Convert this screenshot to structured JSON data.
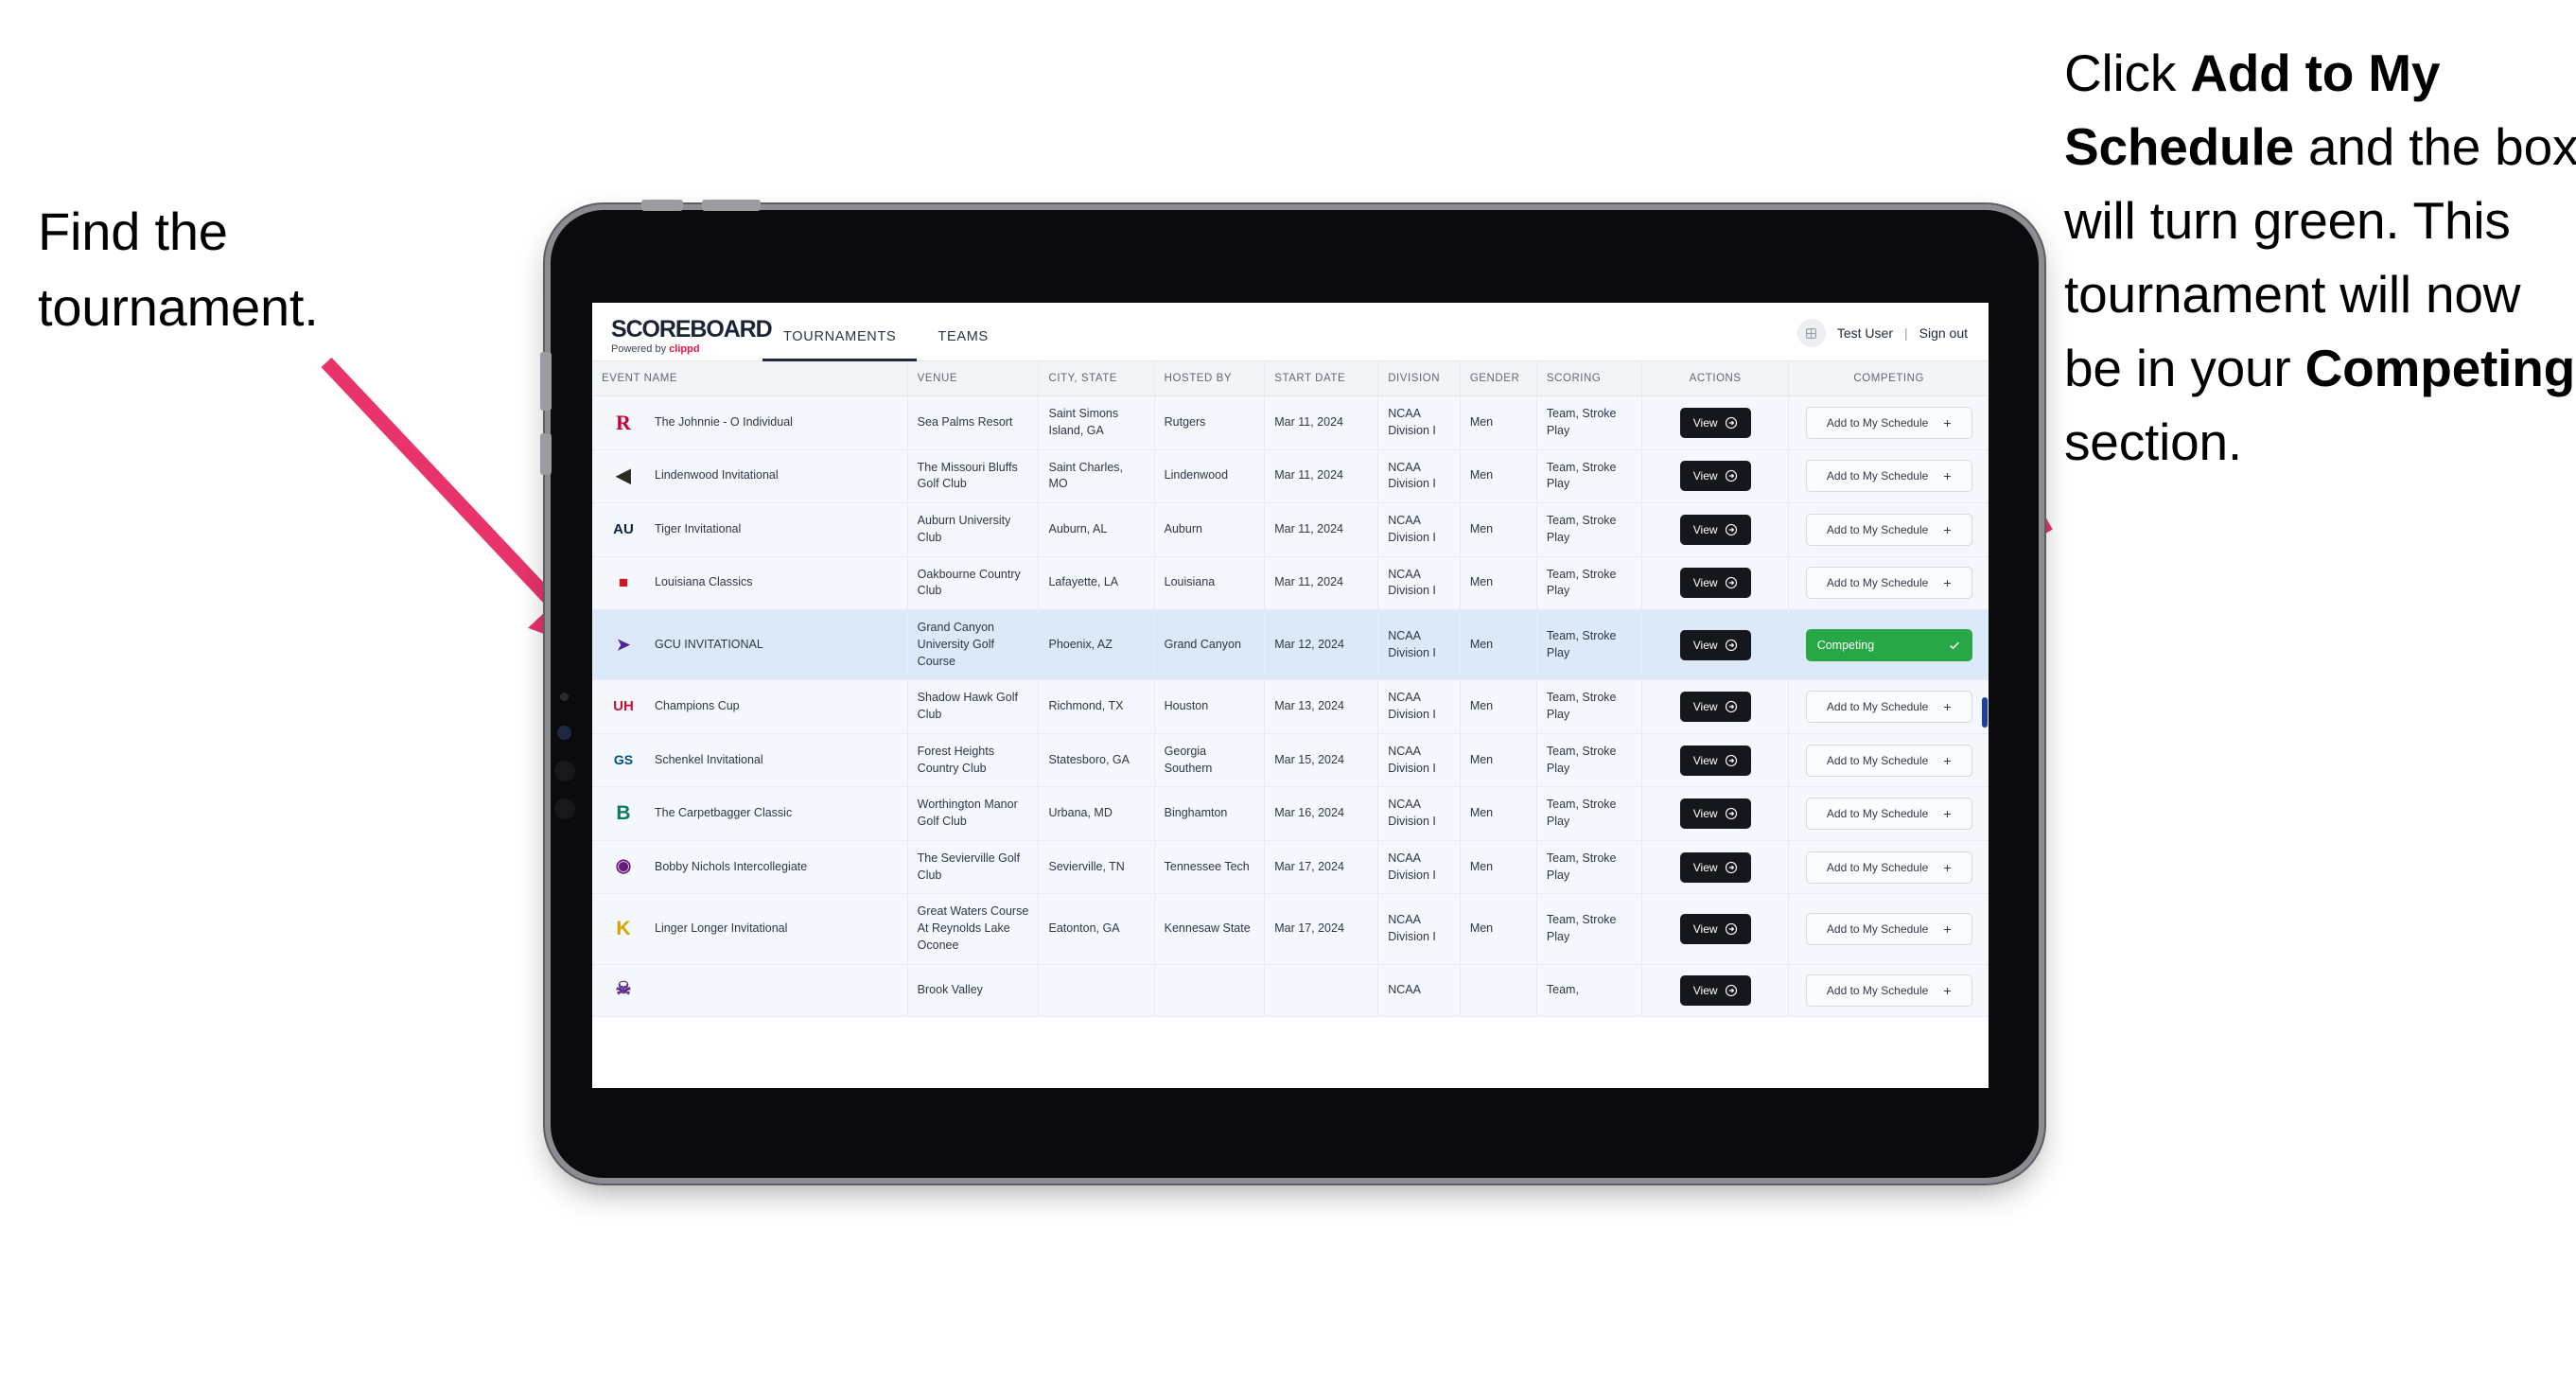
{
  "annotations": {
    "left": "Find the tournament.",
    "right_parts": [
      {
        "t": "Click ",
        "b": false
      },
      {
        "t": "Add to My Schedule",
        "b": true
      },
      {
        "t": " and the box will turn green. This tournament will now be in your ",
        "b": false
      },
      {
        "t": "Competing",
        "b": true
      },
      {
        "t": " section.",
        "b": false
      }
    ],
    "arrow_color": "#e8336b"
  },
  "app": {
    "brand": {
      "title": "SCOREBOARD",
      "sub_prefix": "Powered by ",
      "sub_brand": "clippd"
    },
    "nav": [
      {
        "label": "TOURNAMENTS",
        "active": true
      },
      {
        "label": "TEAMS",
        "active": false
      }
    ],
    "header_right": {
      "avatar_icon": "user-grid-icon",
      "user": "Test User",
      "separator": "|",
      "sign_out": "Sign out"
    },
    "table": {
      "columns": [
        "EVENT NAME",
        "VENUE",
        "CITY, STATE",
        "HOSTED BY",
        "START DATE",
        "DIVISION",
        "GENDER",
        "SCORING",
        "ACTIONS",
        "COMPETING"
      ],
      "view_label": "View",
      "add_label": "Add to My Schedule",
      "competing_label": "Competing",
      "rows": [
        {
          "event": "The Johnnie - O Individual",
          "logo": "rutgers-logo",
          "venue": "Sea Palms Resort",
          "city": "Saint Simons Island, GA",
          "host": "Rutgers",
          "date": "Mar 11, 2024",
          "division": "NCAA Division I",
          "gender": "Men",
          "scoring": "Team, Stroke Play",
          "competing": false,
          "selected": false
        },
        {
          "event": "Lindenwood Invitational",
          "logo": "lindenwood-logo",
          "venue": "The Missouri Bluffs Golf Club",
          "city": "Saint Charles, MO",
          "host": "Lindenwood",
          "date": "Mar 11, 2024",
          "division": "NCAA Division I",
          "gender": "Men",
          "scoring": "Team, Stroke Play",
          "competing": false,
          "selected": false
        },
        {
          "event": "Tiger Invitational",
          "logo": "auburn-logo",
          "venue": "Auburn University Club",
          "city": "Auburn, AL",
          "host": "Auburn",
          "date": "Mar 11, 2024",
          "division": "NCAA Division I",
          "gender": "Men",
          "scoring": "Team, Stroke Play",
          "competing": false,
          "selected": false
        },
        {
          "event": "Louisiana Classics",
          "logo": "ragin-cajuns-logo",
          "venue": "Oakbourne Country Club",
          "city": "Lafayette, LA",
          "host": "Louisiana",
          "date": "Mar 11, 2024",
          "division": "NCAA Division I",
          "gender": "Men",
          "scoring": "Team, Stroke Play",
          "competing": false,
          "selected": false
        },
        {
          "event": "GCU INVITATIONAL",
          "logo": "gcu-lopes-logo",
          "venue": "Grand Canyon University Golf Course",
          "city": "Phoenix, AZ",
          "host": "Grand Canyon",
          "date": "Mar 12, 2024",
          "division": "NCAA Division I",
          "gender": "Men",
          "scoring": "Team, Stroke Play",
          "competing": true,
          "selected": true
        },
        {
          "event": "Champions Cup",
          "logo": "houston-logo",
          "venue": "Shadow Hawk Golf Club",
          "city": "Richmond, TX",
          "host": "Houston",
          "date": "Mar 13, 2024",
          "division": "NCAA Division I",
          "gender": "Men",
          "scoring": "Team, Stroke Play",
          "competing": false,
          "selected": false
        },
        {
          "event": "Schenkel Invitational",
          "logo": "georgia-southern-logo",
          "venue": "Forest Heights Country Club",
          "city": "Statesboro, GA",
          "host": "Georgia Southern",
          "date": "Mar 15, 2024",
          "division": "NCAA Division I",
          "gender": "Men",
          "scoring": "Team, Stroke Play",
          "competing": false,
          "selected": false
        },
        {
          "event": "The Carpetbagger Classic",
          "logo": "binghamton-logo",
          "venue": "Worthington Manor Golf Club",
          "city": "Urbana, MD",
          "host": "Binghamton",
          "date": "Mar 16, 2024",
          "division": "NCAA Division I",
          "gender": "Men",
          "scoring": "Team, Stroke Play",
          "competing": false,
          "selected": false
        },
        {
          "event": "Bobby Nichols Intercollegiate",
          "logo": "tennessee-tech-logo",
          "venue": "The Sevierville Golf Club",
          "city": "Sevierville, TN",
          "host": "Tennessee Tech",
          "date": "Mar 17, 2024",
          "division": "NCAA Division I",
          "gender": "Men",
          "scoring": "Team, Stroke Play",
          "competing": false,
          "selected": false
        },
        {
          "event": "Linger Longer Invitational",
          "logo": "kennesaw-state-logo",
          "venue": "Great Waters Course At Reynolds Lake Oconee",
          "city": "Eatonton, GA",
          "host": "Kennesaw State",
          "date": "Mar 17, 2024",
          "division": "NCAA Division I",
          "gender": "Men",
          "scoring": "Team, Stroke Play",
          "competing": false,
          "selected": false
        },
        {
          "event": "",
          "logo": "ecu-pirates-logo",
          "venue": "Brook Valley",
          "city": "",
          "host": "",
          "date": "",
          "division": "NCAA",
          "gender": "",
          "scoring": "Team,",
          "competing": false,
          "selected": false,
          "clipped": true
        }
      ]
    }
  }
}
